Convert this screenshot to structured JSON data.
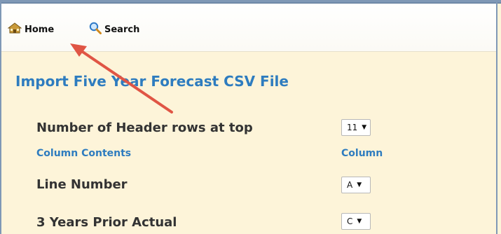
{
  "toolbar": {
    "home_label": "Home",
    "search_label": "Search"
  },
  "page": {
    "title": "Import Five Year Forecast CSV File"
  },
  "form": {
    "header_rows": {
      "label": "Number of Header rows at top",
      "value": "11"
    },
    "column_contents_heading": "Column Contents",
    "column_heading": "Column",
    "rows": [
      {
        "label": "Line Number",
        "value": "A"
      },
      {
        "label": "3 Years Prior Actual",
        "value": "C"
      }
    ]
  },
  "colors": {
    "accent": "#2e7cbf",
    "background": "#fdf4d9",
    "annotation_arrow": "#e05545"
  }
}
